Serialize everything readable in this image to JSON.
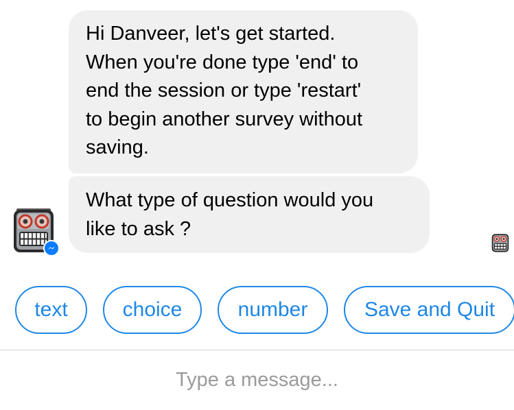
{
  "messages": [
    {
      "lines": [
        "Hi Danveer, let's get started.",
        "When you're done type 'end' to",
        "end the session or type 'restart'",
        "to begin another survey without",
        "saving."
      ]
    },
    {
      "lines": [
        "What type of question would you",
        "like to ask ?"
      ]
    }
  ],
  "avatar": {
    "icon": "robot-avatar-icon",
    "badge_icon": "messenger-badge-icon",
    "badge_color": "#0a7cff"
  },
  "read_receipt": {
    "icon": "robot-read-receipt-icon"
  },
  "quick_replies": [
    {
      "label": "text"
    },
    {
      "label": "choice"
    },
    {
      "label": "number"
    },
    {
      "label": "Save and Quit"
    }
  ],
  "composer": {
    "placeholder": "Type a message...",
    "value": ""
  },
  "colors": {
    "bubble_background": "#f1f0f0",
    "quick_reply_accent": "#1d87e6",
    "placeholder_text": "#9a9a9a",
    "divider": "#d5d5d5"
  }
}
